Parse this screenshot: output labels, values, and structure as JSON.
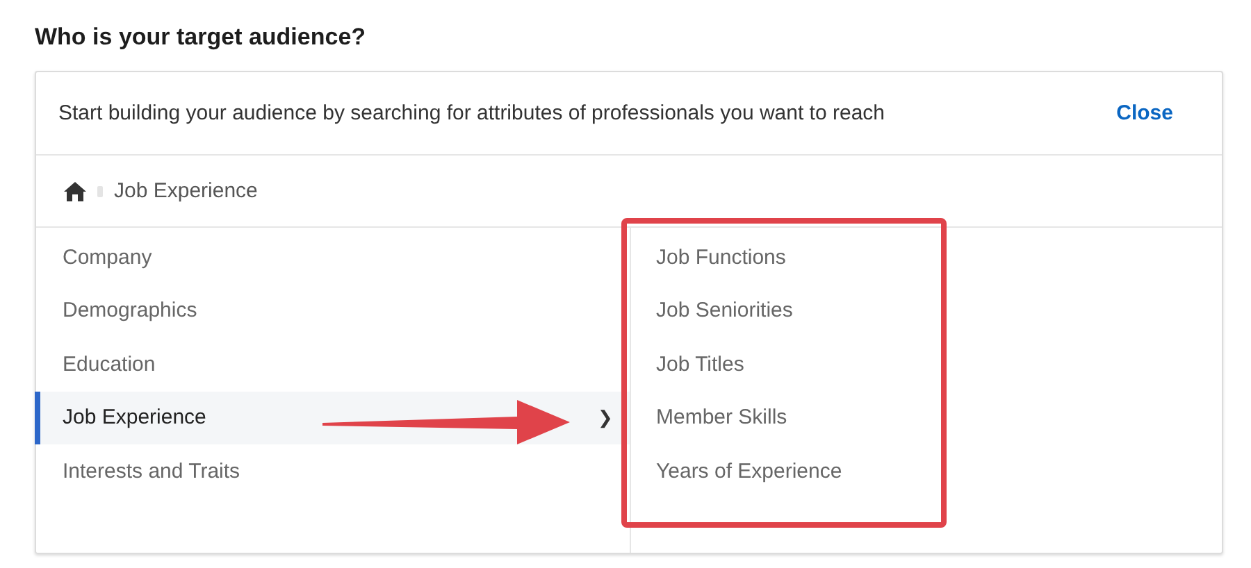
{
  "heading": "Who is your target audience?",
  "panel": {
    "intro": "Start building your audience by searching for attributes of professionals you want to reach",
    "close": "Close"
  },
  "breadcrumb": {
    "current": "Job Experience"
  },
  "categories": [
    {
      "label": "Company",
      "selected": false
    },
    {
      "label": "Demographics",
      "selected": false
    },
    {
      "label": "Education",
      "selected": false
    },
    {
      "label": "Job Experience",
      "selected": true,
      "chevron": "❯"
    },
    {
      "label": "Interests and Traits",
      "selected": false
    }
  ],
  "subcategories": [
    {
      "label": "Job Functions"
    },
    {
      "label": "Job Seniorities"
    },
    {
      "label": "Job Titles"
    },
    {
      "label": "Member Skills"
    },
    {
      "label": "Years of Experience"
    }
  ]
}
